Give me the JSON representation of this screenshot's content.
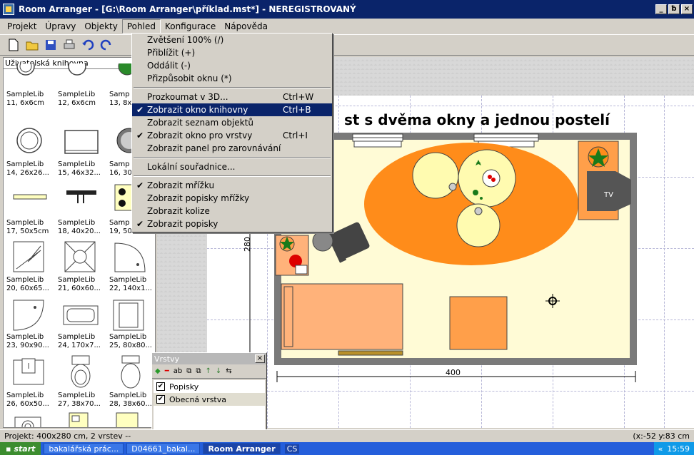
{
  "window": {
    "title": "Room Arranger - [G:\\Room Arranger\\příklad.mst*] - NEREGISTROVANÝ",
    "min": "_",
    "max": "ƀ",
    "close": "×"
  },
  "menubar": [
    "Projekt",
    "Úpravy",
    "Objekty",
    "Pohled",
    "Konfigurace",
    "Nápověda"
  ],
  "library": {
    "header": "Uživatelská knihovna",
    "items": [
      {
        "name": "SampleLib",
        "size": "11, 6x6cm"
      },
      {
        "name": "SampleLib",
        "size": "12, 6x6cm"
      },
      {
        "name": "Samp",
        "size": "13, 8x"
      },
      {
        "name": "SampleLib",
        "size": "14, 26x26..."
      },
      {
        "name": "SampleLib",
        "size": "15, 46x32..."
      },
      {
        "name": "Samp",
        "size": "16, 30:"
      },
      {
        "name": "SampleLib",
        "size": "17, 50x5cm"
      },
      {
        "name": "SampleLib",
        "size": "18, 40x20..."
      },
      {
        "name": "Samp",
        "size": "19, 50:"
      },
      {
        "name": "SampleLib",
        "size": "20, 60x65..."
      },
      {
        "name": "SampleLib",
        "size": "21, 60x60..."
      },
      {
        "name": "SampleLib",
        "size": "22, 140x1..."
      },
      {
        "name": "SampleLib",
        "size": "23, 90x90..."
      },
      {
        "name": "SampleLib",
        "size": "24, 170x7..."
      },
      {
        "name": "SampleLib",
        "size": "25, 80x80..."
      },
      {
        "name": "SampleLib",
        "size": "26, 60x50..."
      },
      {
        "name": "SampleLib",
        "size": "27, 38x70..."
      },
      {
        "name": "SampleLib",
        "size": "28, 38x60..."
      }
    ]
  },
  "dropdown": {
    "group1": [
      {
        "label": "Zvětšení 100% (/)",
        "shortcut": "",
        "checked": false
      },
      {
        "label": "Přiblížit (+)",
        "shortcut": "",
        "checked": false
      },
      {
        "label": "Oddálit (-)",
        "shortcut": "",
        "checked": false
      },
      {
        "label": "Přizpůsobit oknu (*)",
        "shortcut": "",
        "checked": false
      }
    ],
    "group2": [
      {
        "label": "Prozkoumat v 3D...",
        "shortcut": "Ctrl+W",
        "checked": false
      },
      {
        "label": "Zobrazit okno knihovny",
        "shortcut": "Ctrl+B",
        "checked": true,
        "selected": true
      },
      {
        "label": "Zobrazit seznam objektů",
        "shortcut": "",
        "checked": false
      },
      {
        "label": "Zobrazit okno pro vrstvy",
        "shortcut": "Ctrl+I",
        "checked": true
      },
      {
        "label": "Zobrazit panel pro zarovnávání",
        "shortcut": "",
        "checked": false
      }
    ],
    "group3": [
      {
        "label": "Lokální souřadnice...",
        "shortcut": "",
        "checked": false
      }
    ],
    "group4": [
      {
        "label": "Zobrazit mřížku",
        "shortcut": "",
        "checked": true
      },
      {
        "label": "Zobrazit popisky mřížky",
        "shortcut": "",
        "checked": false
      },
      {
        "label": "Zobrazit kolize",
        "shortcut": "",
        "checked": false
      },
      {
        "label": "Zobrazit popisky",
        "shortcut": "",
        "checked": true
      }
    ]
  },
  "canvas": {
    "title": "st s dvěma okny a jednou postelí",
    "dim_height": "280",
    "dim_width": "400",
    "tv_label": "TV"
  },
  "layers": {
    "title": "Vrstvy",
    "close": "×",
    "toolbar": [
      "◆",
      "━",
      "ab",
      "⧉",
      "⧉",
      "↑",
      "↓",
      "⇆"
    ],
    "items": [
      {
        "label": "Popisky",
        "checked": true
      },
      {
        "label": "Obecná vrstva",
        "checked": true
      }
    ]
  },
  "statusbar": {
    "left": "Projekt: 400x280 cm, 2 vrstev --",
    "right": "(x:-52 y:83 cm"
  },
  "taskbar": {
    "start": "start",
    "tasks": [
      {
        "label": "bakalářská prác...",
        "active": false
      },
      {
        "label": "D04661_bakal...",
        "active": false
      },
      {
        "label": "Room Arranger",
        "active": true
      }
    ],
    "lang": "CS",
    "time": "15:59"
  },
  "colors": {
    "titlebar": "#0a246a",
    "menu_selected": "#0a246a",
    "floor": "#fffbd6",
    "rug": "#ff8c1a",
    "furniture": "#ffb27a",
    "wall": "#7a7a7a"
  }
}
